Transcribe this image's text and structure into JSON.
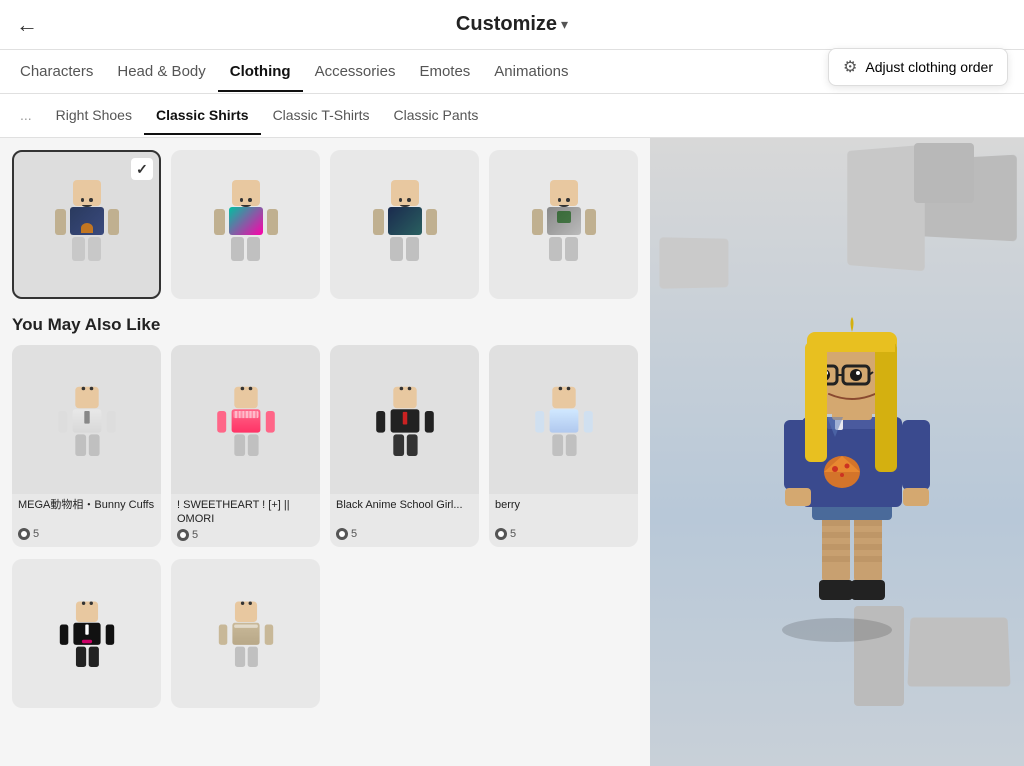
{
  "header": {
    "title": "Customize",
    "back_icon": "←",
    "chevron": "▾"
  },
  "adjust_button": {
    "label": "Adjust clothing order",
    "icon": "⚙"
  },
  "nav_tabs_1": {
    "items": [
      {
        "id": "characters",
        "label": "Characters",
        "active": false
      },
      {
        "id": "head-body",
        "label": "Head & Body",
        "active": false
      },
      {
        "id": "clothing",
        "label": "Clothing",
        "active": true
      },
      {
        "id": "accessories",
        "label": "Accessories",
        "active": false
      },
      {
        "id": "emotes",
        "label": "Emotes",
        "active": false
      },
      {
        "id": "animations",
        "label": "Animations",
        "active": false
      }
    ]
  },
  "nav_tabs_2": {
    "items": [
      {
        "id": "left-shoes",
        "label": "...",
        "active": false
      },
      {
        "id": "right-shoes",
        "label": "Right Shoes",
        "active": false
      },
      {
        "id": "classic-shirts",
        "label": "Classic Shirts",
        "active": true
      },
      {
        "id": "classic-tshirts",
        "label": "Classic T-Shirts",
        "active": false
      },
      {
        "id": "classic-pants",
        "label": "Classic Pants",
        "active": false
      }
    ]
  },
  "items_grid": {
    "items": [
      {
        "id": "item1",
        "selected": true,
        "shirt_type": "navy"
      },
      {
        "id": "item2",
        "selected": false,
        "shirt_type": "teal"
      },
      {
        "id": "item3",
        "selected": false,
        "shirt_type": "dark-blue"
      },
      {
        "id": "item4",
        "selected": false,
        "shirt_type": "gray"
      }
    ]
  },
  "recommendations": {
    "title": "You May Also Like",
    "items": [
      {
        "id": "rec1",
        "name": "MEGA動物相・Bunny Cuffs",
        "price": "5",
        "shirt_type": "white-formal"
      },
      {
        "id": "rec2",
        "name": "! SWEETHEART ! [+] || OMORI",
        "price": "5",
        "shirt_type": "pink-red"
      },
      {
        "id": "rec3",
        "name": "Black Anime School Girl...",
        "price": "5",
        "shirt_type": "black-red"
      },
      {
        "id": "rec4",
        "name": "berry",
        "price": "5",
        "shirt_type": "light-blue"
      }
    ]
  },
  "bottom_items": [
    {
      "id": "bot1",
      "shirt_type": "black-tux"
    },
    {
      "id": "bot2",
      "shirt_type": "gray-maid"
    }
  ]
}
